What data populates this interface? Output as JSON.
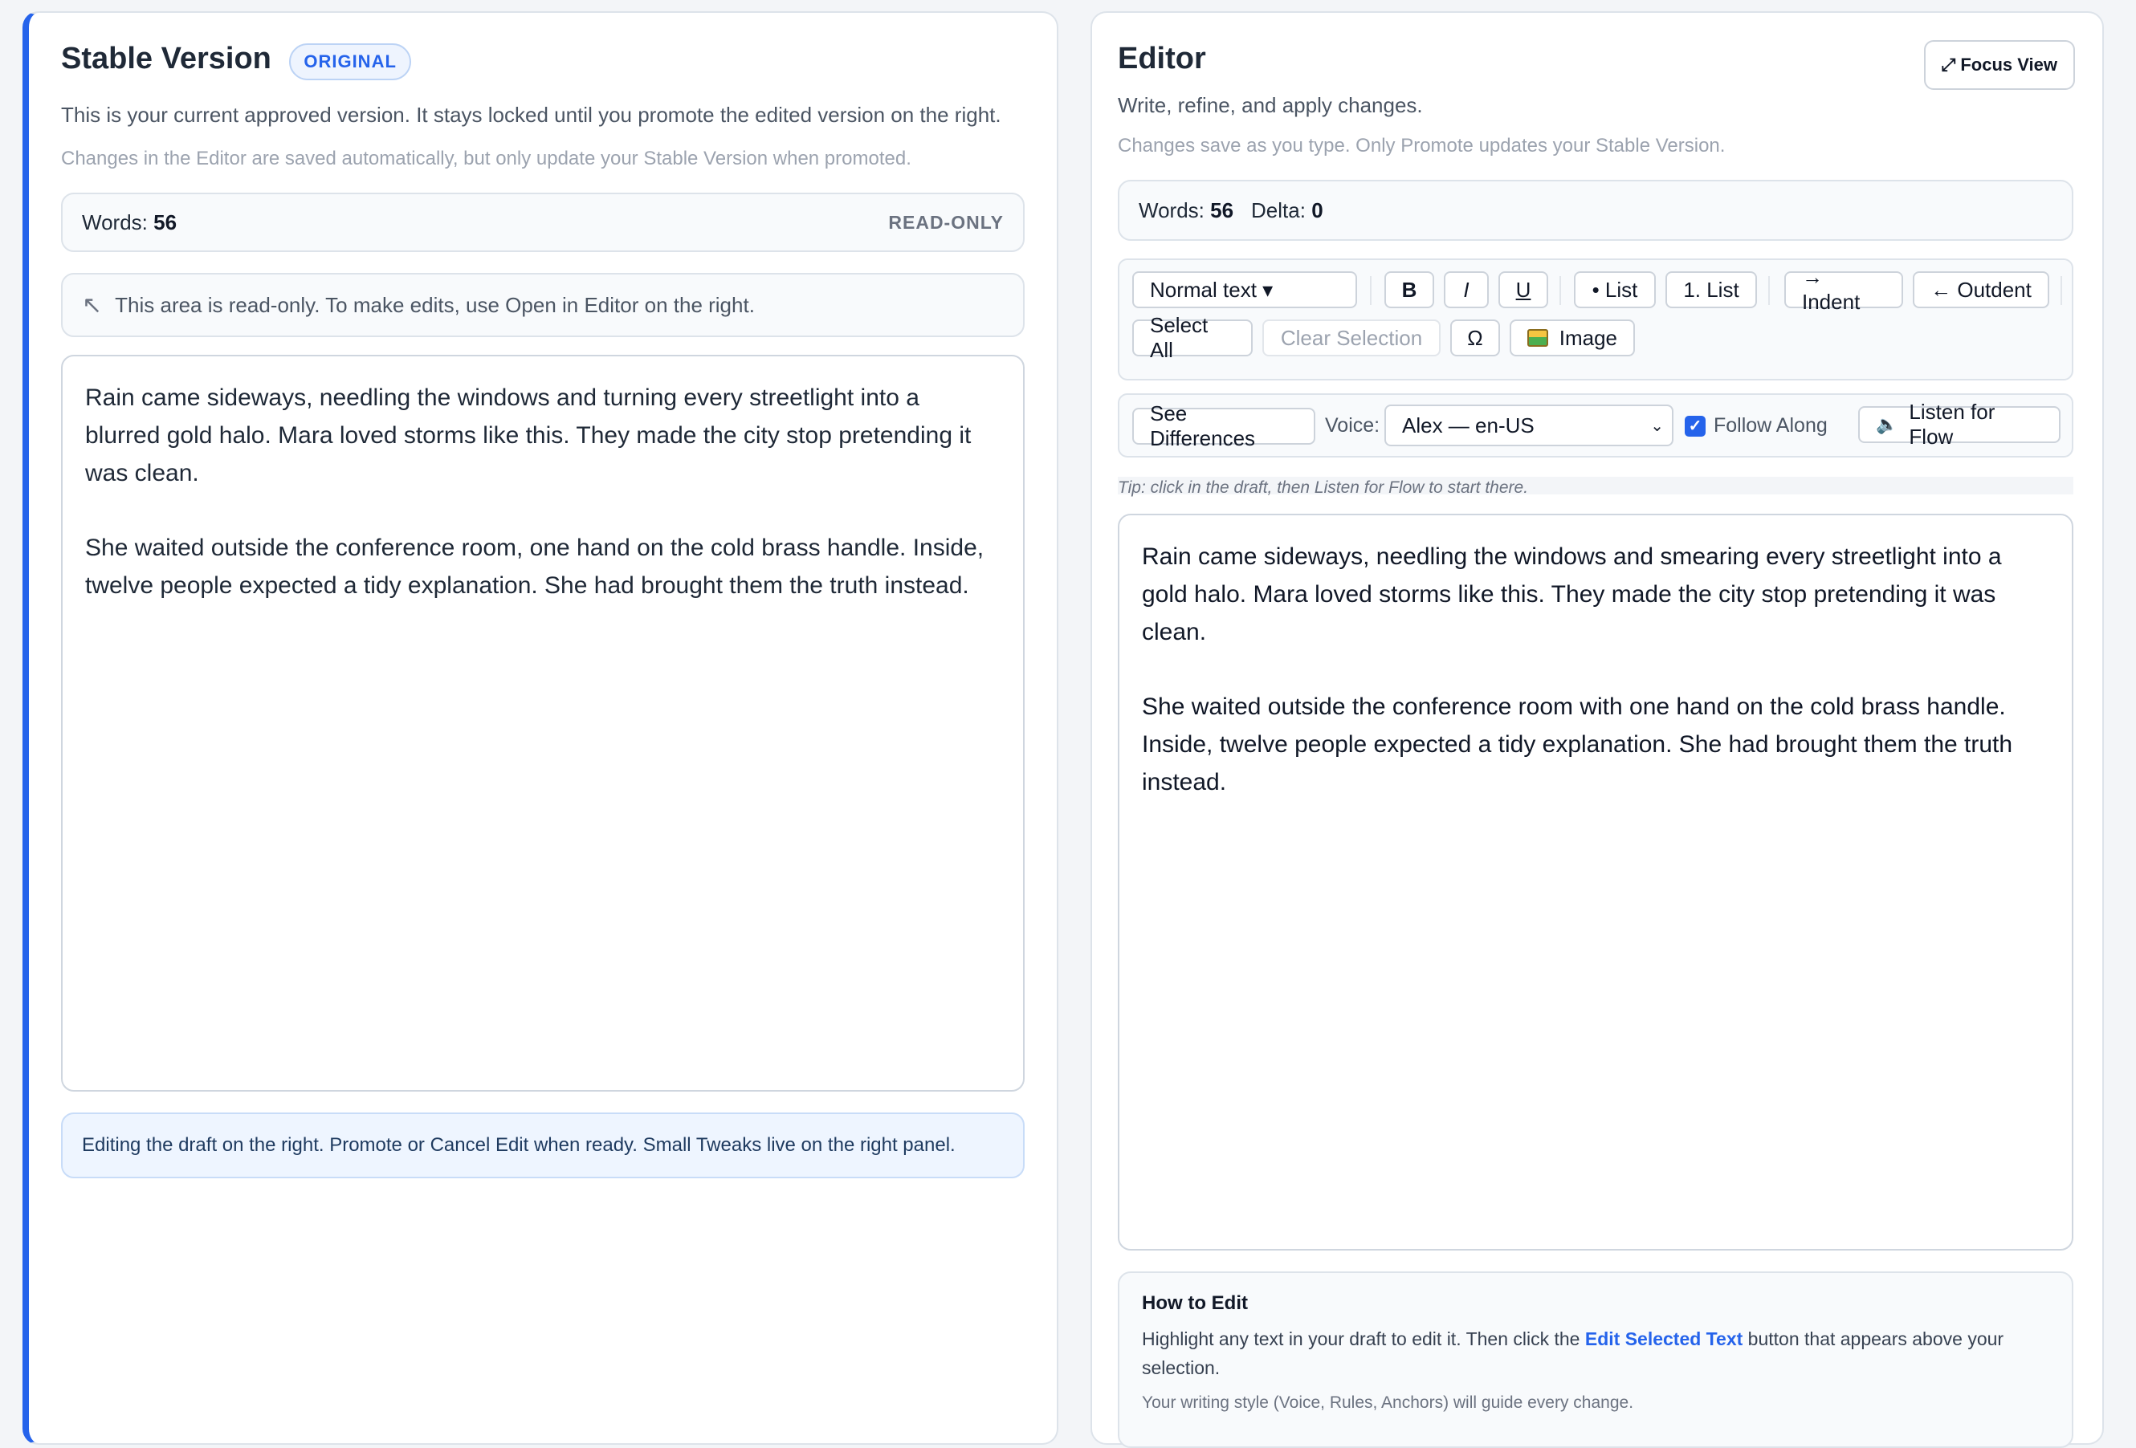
{
  "stable": {
    "title": "Stable Version",
    "badge": "ORIGINAL",
    "description": "This is your current approved version. It stays locked until you promote the edited version on the right.",
    "subdescription": "Changes in the Editor are saved automatically, but only update your Stable Version when promoted.",
    "words_label": "Words:",
    "words_value": "56",
    "readonly_label": "READ-ONLY",
    "notice_icon": "arrow-up-left-icon",
    "notice_glyph": "↖",
    "notice_text": "This area is read-only. To make edits, use Open in Editor on the right.",
    "paragraphs": [
      "Rain came sideways, needling the windows and turning every streetlight into a blurred gold halo. Mara loved storms like this. They made the city stop pretending it was clean.",
      "She waited outside the conference room, one hand on the cold brass handle. Inside, twelve people expected a tidy explanation. She had brought them the truth instead."
    ],
    "info_text": "Editing the draft on the right. Promote or Cancel Edit when ready. Small Tweaks live on the right panel."
  },
  "editor": {
    "title": "Editor",
    "focus_view_label": "⤢ Focus View",
    "description": "Write, refine, and apply changes.",
    "subdescription": "Changes save as you type. Only Promote updates your Stable Version.",
    "words_label": "Words:",
    "words_value": "56",
    "delta_label": "Delta:",
    "delta_value": "0",
    "toolbar": {
      "text_style": "Normal text ▾",
      "bold": "B",
      "italic": "I",
      "underline": "U",
      "bullet_list": "• List",
      "numbered_list": "1. List",
      "indent": "→ Indent",
      "outdent": "← Outdent",
      "select_all": "Select All",
      "clear_selection": "Clear Selection",
      "special_char": "Ω",
      "image": "Image"
    },
    "audio_bar": {
      "see_differences": "See Differences",
      "voice_label": "Voice:",
      "voice_value": "Alex — en-US",
      "follow_along_label": "Follow Along",
      "follow_along_checked": true,
      "listen_label": "Listen for Flow",
      "listen_icon": "speaker-icon"
    },
    "tip": "Tip: click in the draft, then Listen for Flow to start there.",
    "paragraphs": [
      "Rain came sideways, needling the windows and smearing every streetlight into a gold halo. Mara loved storms like this. They made the city stop pretending it was clean.",
      "She waited outside the conference room with one hand on the cold brass handle. Inside, twelve people expected a tidy explanation. She had brought them the truth instead."
    ],
    "how_to": {
      "title": "How to Edit",
      "text_before": "Highlight any text in your draft to edit it. Then click the ",
      "highlight": "Edit Selected Text",
      "text_after": " button that appears above your selection.",
      "note": "Your writing style (Voice, Rules, Anchors) will guide every change."
    }
  },
  "colors": {
    "accent": "#2563eb",
    "background": "#f3f5f8",
    "info_background": "#eef5ff"
  }
}
